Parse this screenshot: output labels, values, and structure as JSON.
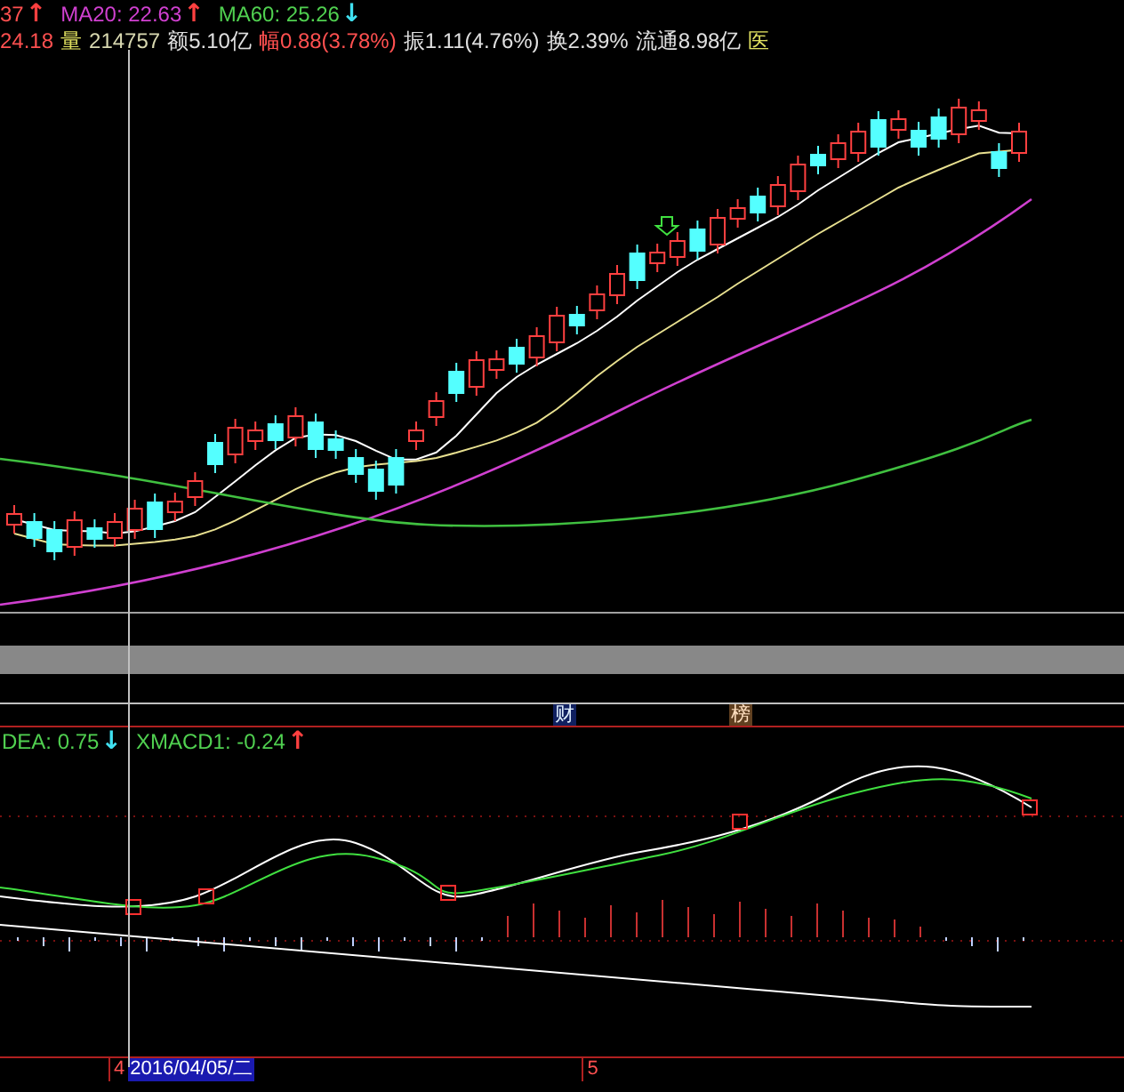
{
  "indicators": [
    {
      "label": "37",
      "color": "#ff5050",
      "arrow": {
        "glyph": "↑",
        "color": "#ff4040"
      }
    },
    {
      "label": "MA20: 22.63",
      "color": "#d040d0",
      "arrow": {
        "glyph": "↑",
        "color": "#ff4040"
      }
    },
    {
      "label": "MA60: 25.26",
      "color": "#50d050",
      "arrow": {
        "glyph": "↓",
        "color": "#40e0f0"
      }
    }
  ],
  "quote": [
    {
      "text": "24.18",
      "color": "#ff5050"
    },
    {
      "text": "量",
      "color": "#e0e060"
    },
    {
      "text": "214757",
      "color": "#d8d8b0"
    },
    {
      "text": "额5.10亿",
      "color": "#e0e0e0"
    },
    {
      "text": "幅0.88(3.78%)",
      "color": "#ff5050"
    },
    {
      "text": "振1.11(4.76%)",
      "color": "#e0e0e0"
    },
    {
      "text": "换2.39%",
      "color": "#e0e0e0"
    },
    {
      "text": "流通8.98亿",
      "color": "#e0e0e0"
    },
    {
      "text": "医",
      "color": "#e0e060"
    }
  ],
  "flags": {
    "finance": "财",
    "ranking": "榜"
  },
  "macd_header": [
    {
      "label": "DEA: 0.75",
      "arrow": {
        "glyph": "↓",
        "color": "#40e0f0"
      }
    },
    {
      "label": "XMACD1: -0.24",
      "arrow": {
        "glyph": "↑",
        "color": "#ff4040"
      }
    }
  ],
  "axis": {
    "start_month": "4",
    "cursor_date": "2016/04/05/二",
    "end_month": "5"
  }
}
